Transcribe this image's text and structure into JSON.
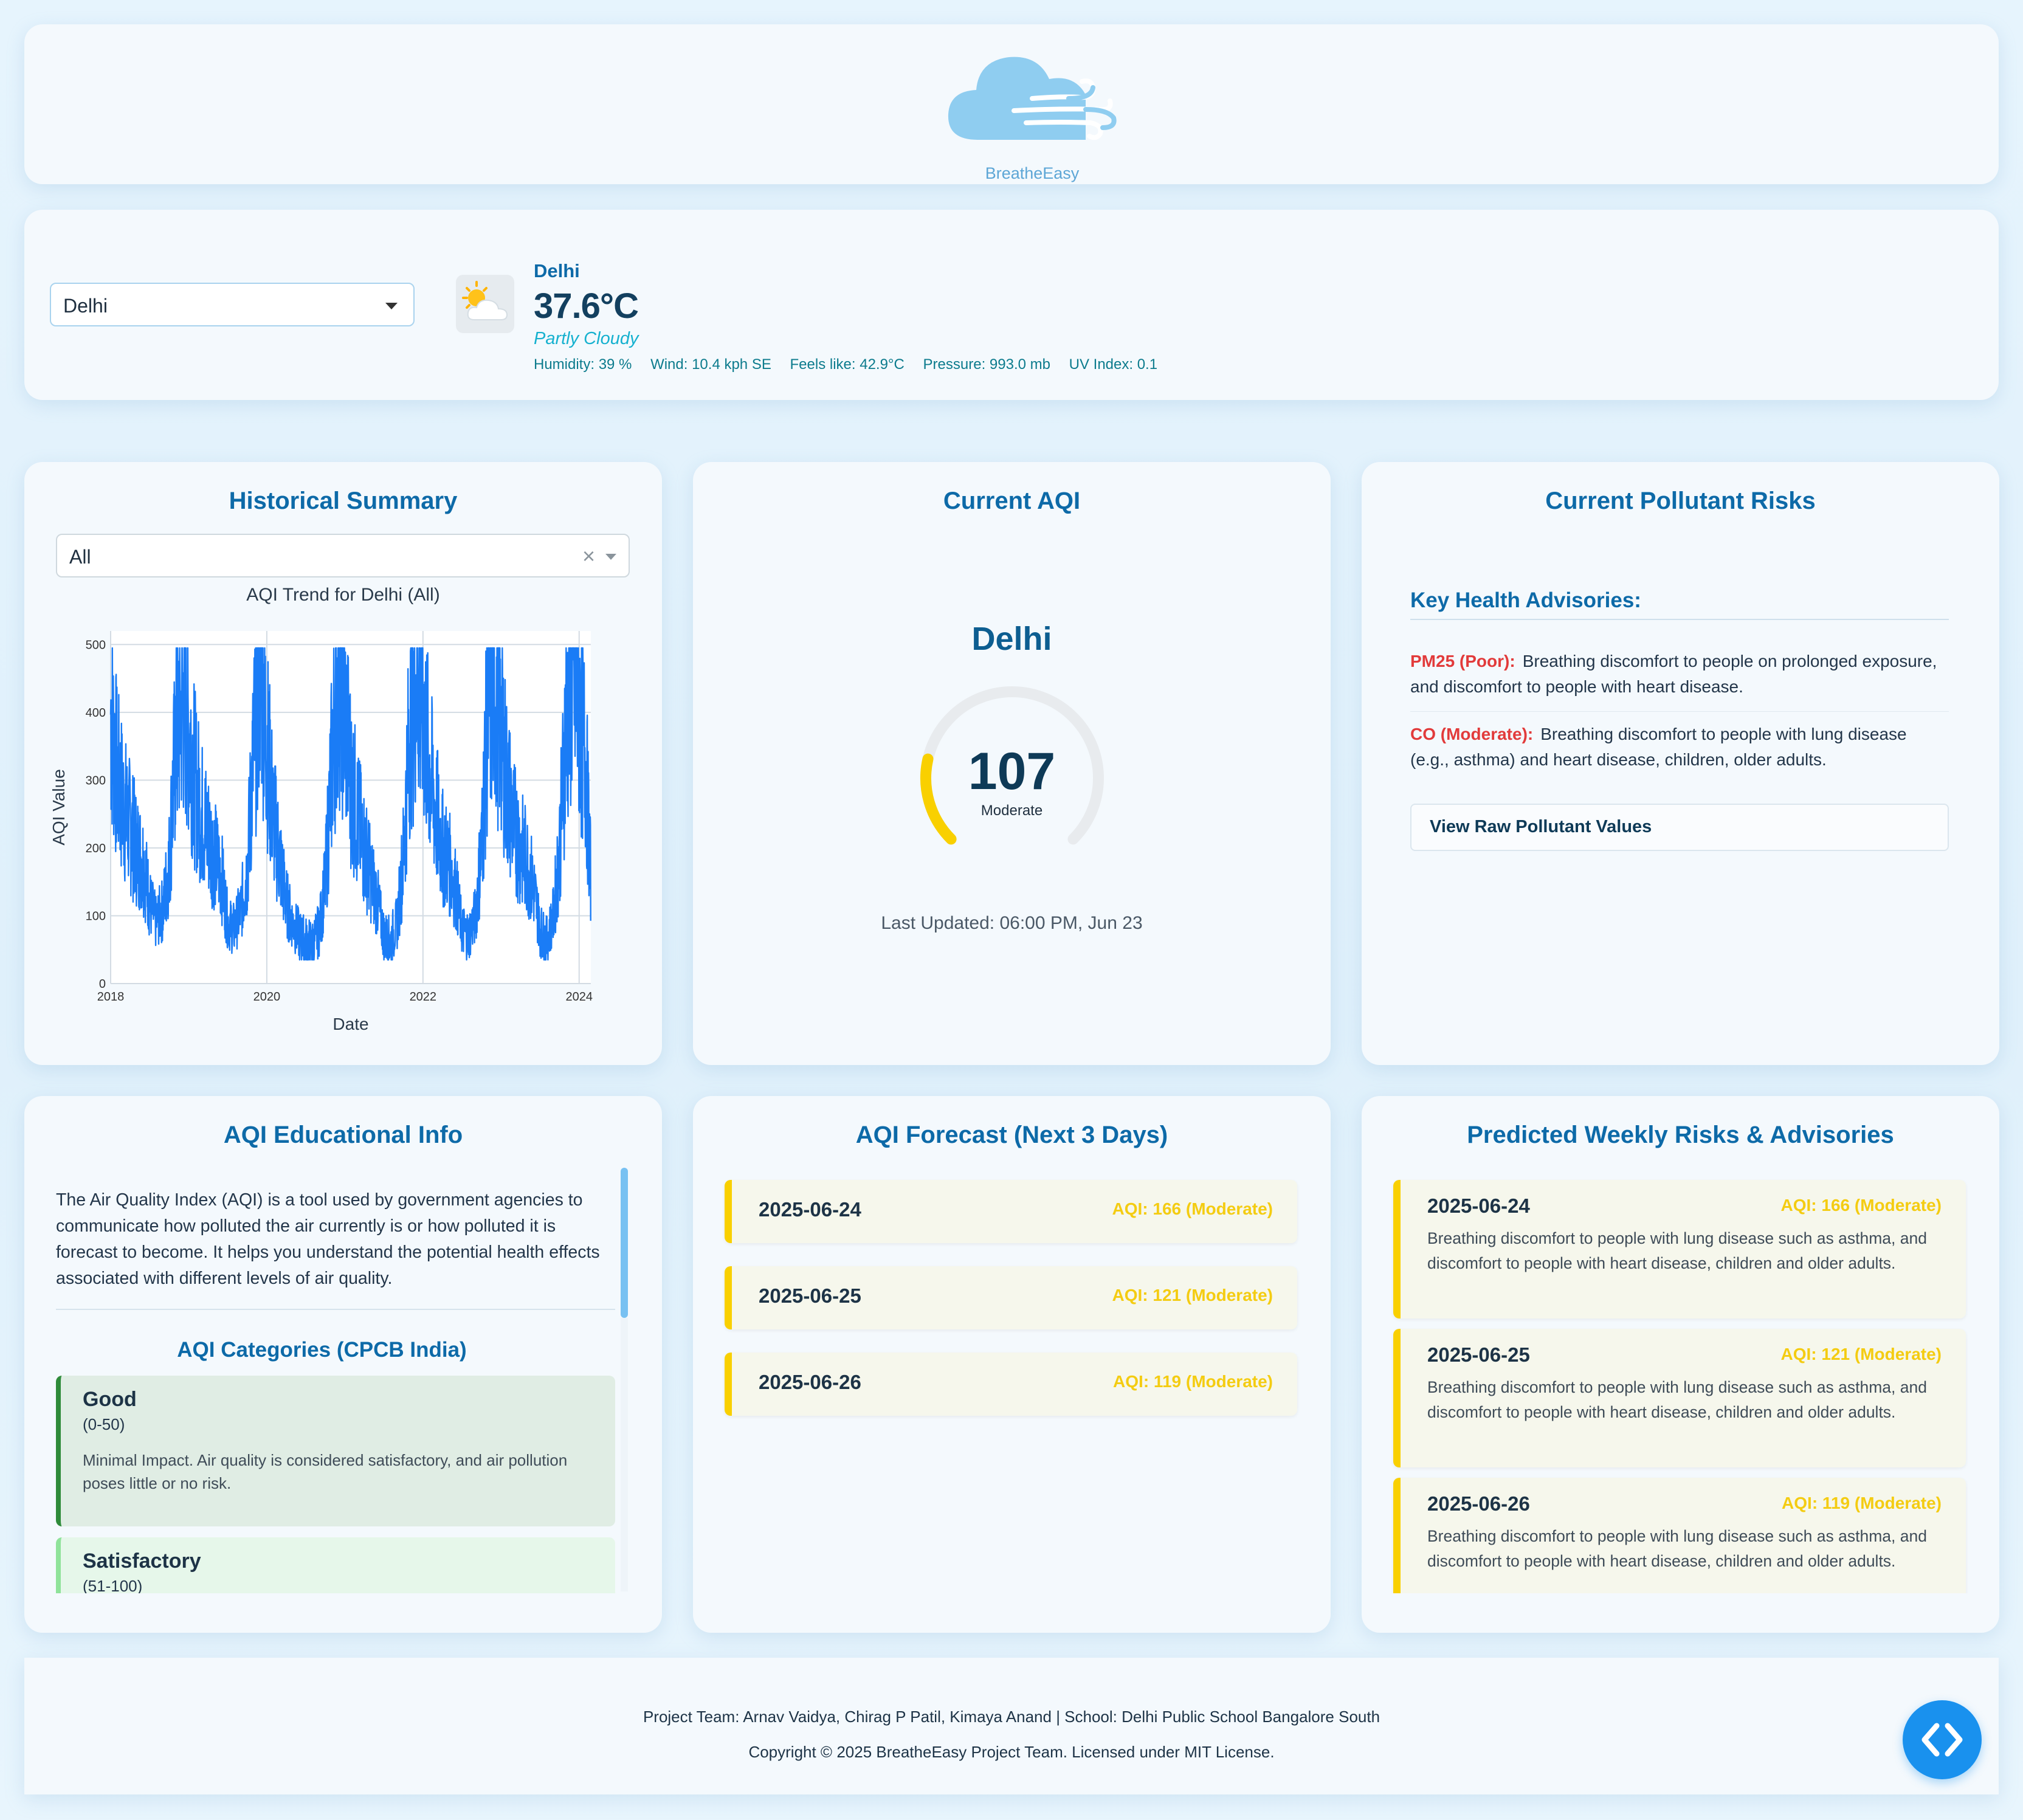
{
  "header": {
    "logo_text": "BreatheEasy"
  },
  "controls": {
    "city_select_value": "Delhi",
    "weather": {
      "icon": "partly-cloudy-icon",
      "city": "Delhi",
      "temperature": "37.6°C",
      "condition": "Partly Cloudy",
      "humidity": "Humidity: 39 %",
      "wind": "Wind: 10.4 kph SE",
      "feels_like": "Feels like: 42.9°C",
      "pressure": "Pressure: 993.0 mb",
      "uv_index": "UV Index: 0.1"
    }
  },
  "historical": {
    "title": "Historical Summary",
    "period_select_value": "All",
    "clear_icon": "×"
  },
  "chart_data": {
    "type": "line",
    "title": "AQI Trend for Delhi (All)",
    "xlabel": "Date",
    "ylabel": "AQI Value",
    "ylim": [
      0,
      520
    ],
    "xlim": [
      2018.0,
      2024.15
    ],
    "xticks": [
      "2018",
      "2020",
      "2022",
      "2024"
    ],
    "yticks": [
      "0",
      "100",
      "200",
      "300",
      "400",
      "500"
    ],
    "grid": true,
    "series_color": "#1a7cf6",
    "series": [
      {
        "x": [
          2018.0,
          2018.08,
          2018.17,
          2018.25,
          2018.33,
          2018.42,
          2018.5,
          2018.58,
          2018.67,
          2018.75,
          2018.83,
          2018.92,
          2019.0,
          2019.08,
          2019.17,
          2019.25,
          2019.33,
          2019.42,
          2019.5,
          2019.58,
          2019.67,
          2019.75,
          2019.83,
          2019.92,
          2020.0,
          2020.08,
          2020.17,
          2020.25,
          2020.33,
          2020.42,
          2020.5,
          2020.58,
          2020.67,
          2020.75,
          2020.83,
          2020.92,
          2021.0,
          2021.08,
          2021.17,
          2021.25,
          2021.33,
          2021.42,
          2021.5,
          2021.58,
          2021.67,
          2021.75,
          2021.83,
          2021.92,
          2022.0,
          2022.08,
          2022.17,
          2022.25,
          2022.33,
          2022.42,
          2022.5,
          2022.58,
          2022.67,
          2022.75,
          2022.83,
          2022.92,
          2023.0,
          2023.08,
          2023.17,
          2023.25,
          2023.33,
          2023.42,
          2023.5,
          2023.58,
          2023.67,
          2023.75,
          2023.83,
          2023.92,
          2024.0,
          2024.08,
          2024.15
        ],
        "values": [
          400,
          310,
          260,
          230,
          200,
          180,
          120,
          90,
          110,
          180,
          350,
          420,
          380,
          300,
          250,
          220,
          190,
          160,
          90,
          80,
          110,
          170,
          340,
          490,
          360,
          250,
          180,
          120,
          90,
          70,
          60,
          55,
          80,
          150,
          320,
          470,
          400,
          300,
          240,
          200,
          160,
          120,
          70,
          60,
          90,
          190,
          380,
          460,
          410,
          320,
          250,
          200,
          180,
          140,
          80,
          70,
          100,
          200,
          400,
          440,
          380,
          290,
          230,
          200,
          180,
          140,
          80,
          60,
          100,
          200,
          380,
          460,
          400,
          340,
          150
        ]
      }
    ]
  },
  "current_aqi": {
    "title": "Current AQI",
    "city": "Delhi",
    "value": 107,
    "gauge_max": 500,
    "category": "Moderate",
    "updated": "Last Updated: 06:00 PM, Jun 23",
    "gauge_color": "#f9d000"
  },
  "pollutant_risks": {
    "title": "Current Pollutant Risks",
    "advisories_title": "Key Health Advisories:",
    "advisories": [
      {
        "label": "PM25 (Poor):",
        "text": "Breathing discomfort to people on prolonged exposure, and discomfort to people with heart disease."
      },
      {
        "label": "CO (Moderate):",
        "text": "Breathing discomfort to people with lung disease (e.g., asthma) and heart disease, children, older adults."
      }
    ],
    "raw_button": "View Raw Pollutant Values"
  },
  "education": {
    "title": "AQI Educational Info",
    "intro": "The Air Quality Index (AQI) is a tool used by government agencies to communicate how polluted the air currently is or how polluted it is forecast to become. It helps you understand the potential health effects associated with different levels of air quality.",
    "categories_title": "AQI Categories (CPCB India)",
    "categories": [
      {
        "name": "Good",
        "range": "(0-50)",
        "text": "Minimal Impact. Air quality is considered satisfactory, and air pollution poses little or no risk.",
        "color": "#2e8b3a"
      },
      {
        "name": "Satisfactory",
        "range": "(51-100)",
        "text": "",
        "color": "#8fe39a"
      }
    ]
  },
  "forecast": {
    "title": "AQI Forecast (Next 3 Days)",
    "days": [
      {
        "date": "2025-06-24",
        "aqi": "AQI: 166 (Moderate)"
      },
      {
        "date": "2025-06-25",
        "aqi": "AQI: 121 (Moderate)"
      },
      {
        "date": "2025-06-26",
        "aqi": "AQI: 119 (Moderate)"
      }
    ]
  },
  "weekly": {
    "title": "Predicted Weekly Risks & Advisories",
    "items": [
      {
        "date": "2025-06-24",
        "aqi": "AQI: 166 (Moderate)",
        "text": "Breathing discomfort to people with lung disease such as asthma, and discomfort to people with heart disease, children and older adults."
      },
      {
        "date": "2025-06-25",
        "aqi": "AQI: 121 (Moderate)",
        "text": "Breathing discomfort to people with lung disease such as asthma, and discomfort to people with heart disease, children and older adults."
      },
      {
        "date": "2025-06-26",
        "aqi": "AQI: 119 (Moderate)",
        "text": "Breathing discomfort to people with lung disease such as asthma, and discomfort to people with heart disease, children and older adults."
      }
    ]
  },
  "footer": {
    "team": "Project Team: Arnav Vaidya, Chirag P Patil, Kimaya Anand | School: Delhi Public School Bangalore South",
    "copyright": "Copyright © 2025 BreatheEasy Project Team. Licensed under MIT License.",
    "embed_icon": "code-brackets-icon"
  }
}
